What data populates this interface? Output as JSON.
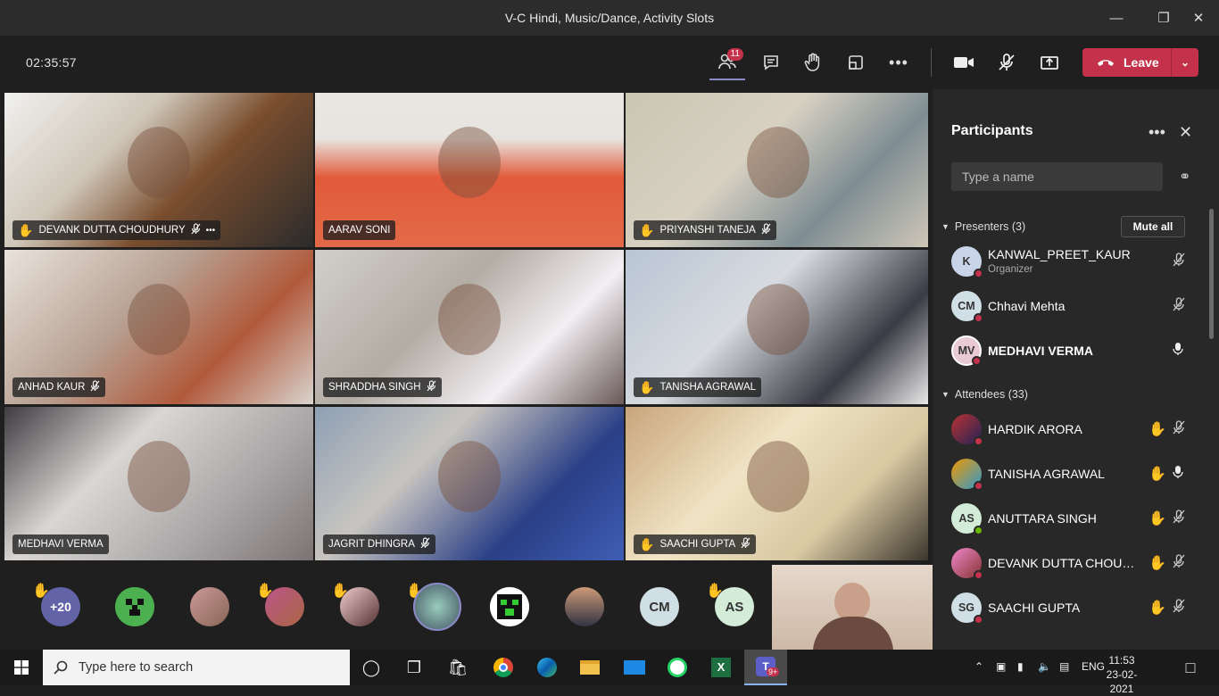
{
  "window": {
    "title": "V-C Hindi, Music/Dance, Activity Slots"
  },
  "toolbar": {
    "timer": "02:35:57",
    "participants_badge": "11",
    "leave_label": "Leave"
  },
  "tiles": [
    {
      "name": "DEVANK DUTTA CHOUDHURY",
      "hand": true,
      "muted": true,
      "more": true
    },
    {
      "name": "AARAV SONI",
      "hand": false,
      "muted": false
    },
    {
      "name": "PRIYANSHI TANEJA",
      "hand": true,
      "muted": true
    },
    {
      "name": "ANHAD KAUR",
      "hand": false,
      "muted": true
    },
    {
      "name": "SHRADDHA SINGH",
      "hand": false,
      "muted": true
    },
    {
      "name": "TANISHA AGRAWAL",
      "hand": true,
      "muted": false
    },
    {
      "name": "MEDHAVI VERMA",
      "hand": false,
      "muted": false
    },
    {
      "name": "JAGRIT DHINGRA",
      "hand": false,
      "muted": true
    },
    {
      "name": "SAACHI GUPTA",
      "hand": true,
      "muted": true
    }
  ],
  "strip": {
    "more_count": "+20",
    "initials": [
      "CM",
      "AS"
    ]
  },
  "panel": {
    "title": "Participants",
    "search_placeholder": "Type a name",
    "presenters_label": "Presenters (3)",
    "mute_all_label": "Mute all",
    "attendees_label": "Attendees (33)",
    "presenters": [
      {
        "initials": "K",
        "name": "KANWAL_PREET_KAUR",
        "role": "Organizer",
        "mic": "muted"
      },
      {
        "initials": "CM",
        "name": "Chhavi Mehta",
        "mic": "muted"
      },
      {
        "initials": "MV",
        "name": "MEDHAVI VERMA",
        "mic": "on",
        "bold": true
      }
    ],
    "attendees": [
      {
        "initials": "",
        "name": "HARDIK ARORA",
        "hand": true,
        "mic": "muted"
      },
      {
        "initials": "",
        "name": "TANISHA AGRAWAL",
        "hand": true,
        "mic": "on"
      },
      {
        "initials": "AS",
        "name": "ANUTTARA SINGH",
        "hand": true,
        "mic": "muted"
      },
      {
        "initials": "",
        "name": "DEVANK DUTTA CHOUD...",
        "hand": true,
        "mic": "muted"
      },
      {
        "initials": "SG",
        "name": "SAACHI GUPTA",
        "hand": true,
        "mic": "muted"
      }
    ]
  },
  "taskbar": {
    "search_placeholder": "Type here to search",
    "teams_badge": "9+",
    "lang": "ENG",
    "time": "11:53",
    "date": "23-02-2021"
  }
}
